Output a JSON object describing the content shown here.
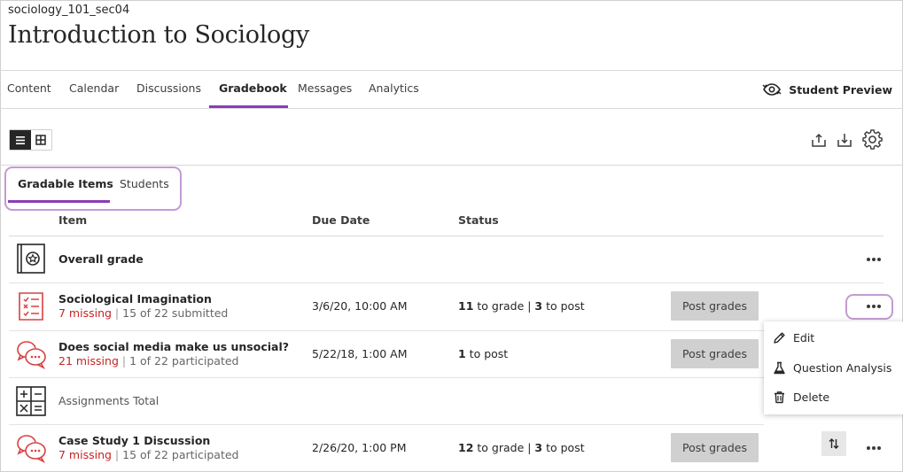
{
  "course": {
    "id": "sociology_101_sec04",
    "title": "Introduction to Sociology"
  },
  "nav": {
    "tabs": [
      "Content",
      "Calendar",
      "Discussions",
      "Gradebook",
      "Messages",
      "Analytics"
    ],
    "active": "Gradebook",
    "student_preview": "Student Preview"
  },
  "subtabs": {
    "gradable": "Gradable Items",
    "students": "Students"
  },
  "columns": {
    "item": "Item",
    "due": "Due Date",
    "status": "Status"
  },
  "rows": [
    {
      "title": "Overall grade"
    },
    {
      "title": "Sociological Imagination",
      "missing": "7 missing",
      "progress": "15 of 22 submitted",
      "due": "3/6/20, 10:00 AM",
      "s1": "11",
      "s1_text": " to grade | ",
      "s2": "3",
      "s2_text": " to post",
      "button": "Post grades"
    },
    {
      "title": "Does social media make us unsocial?",
      "missing": "21 missing",
      "progress": "1 of 22 participated",
      "due": "5/22/18, 1:00 AM",
      "s1": "1",
      "s1_text": " to post",
      "button": "Post grades"
    },
    {
      "title": "Assignments Total"
    },
    {
      "title": "Case Study 1 Discussion",
      "missing": "7 missing",
      "progress": "15 of 22 participated",
      "due": "2/26/20, 1:00 PM",
      "s1": "12",
      "s1_text": " to grade | ",
      "s2": "3",
      "s2_text": " to post",
      "button": "Post grades"
    }
  ],
  "separator": "|",
  "menu": {
    "edit": "Edit",
    "question_analysis": "Question Analysis",
    "delete": "Delete"
  },
  "colors": {
    "accent": "#8c3bb8",
    "highlight": "#c39bd3",
    "missing": "#c52424",
    "icon_red": "#d94040"
  }
}
